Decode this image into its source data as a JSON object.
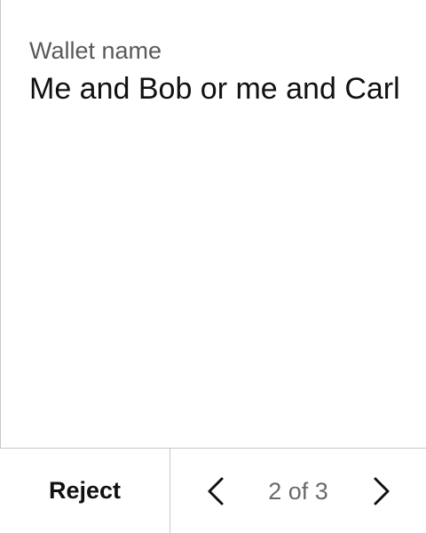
{
  "wallet": {
    "label": "Wallet name",
    "value": "Me and Bob or me and Carl"
  },
  "footer": {
    "reject_label": "Reject",
    "pager": {
      "current": 2,
      "total": 3,
      "text": "2 of 3",
      "prev_icon": "chevron-left-icon",
      "next_icon": "chevron-right-icon"
    }
  }
}
